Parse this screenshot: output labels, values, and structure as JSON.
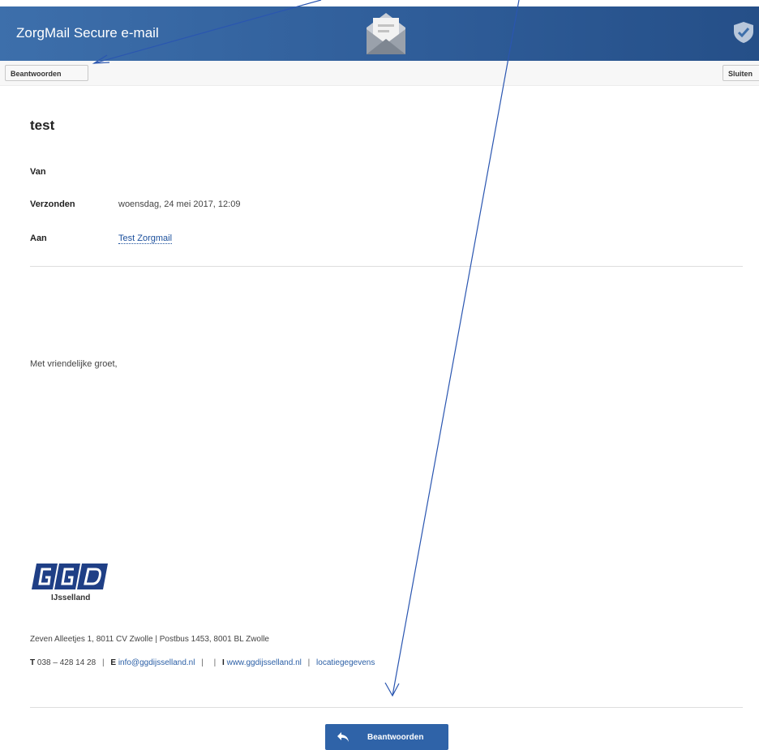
{
  "header": {
    "app_title": "ZorgMail Secure e-mail",
    "envelope_icon": "envelope-open-icon",
    "shield_icon": "shield-check-icon",
    "colors": {
      "bar": "#2f5d99",
      "text": "#ffffff"
    }
  },
  "toolbar": {
    "reply_label": "Beantwoorden",
    "close_label": "Sluiten"
  },
  "message": {
    "subject": "test",
    "from_label": "Van",
    "from_value": "",
    "sent_label": "Verzonden",
    "sent_value": "woensdag, 24 mei 2017, 12:09",
    "to_label": "Aan",
    "to_value": "Test Zorgmail"
  },
  "body": {
    "greeting": "Met vriendelijke groet,"
  },
  "signature": {
    "logo_text": "GGD",
    "logo_subtitle": "IJsselland",
    "address": "Zeven Alleetjes 1,  8011 CV Zwolle  | Postbus 1453, 8001 BL Zwolle",
    "phone_label": "T",
    "phone": "038 – 428 14 28",
    "email_label": "E",
    "email": "info@ggdijsselland.nl",
    "web_label": "I",
    "web": "www.ggdijsselland.nl",
    "location_link": "locatiegegevens"
  },
  "footer": {
    "reply_button_label": "Beantwoorden",
    "reply_icon": "reply-arrow-icon",
    "color": "#2f63a8"
  }
}
